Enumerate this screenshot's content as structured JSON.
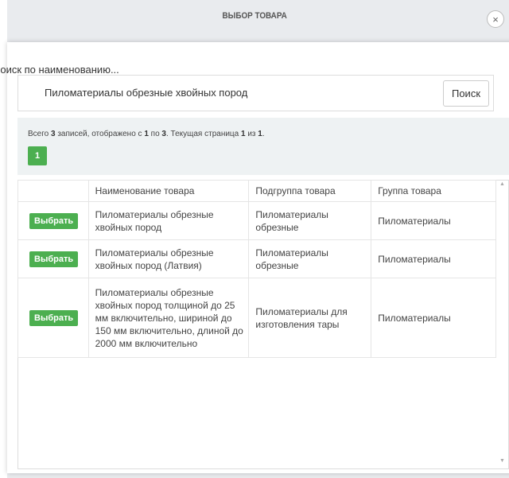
{
  "dialog": {
    "title": "ВЫБОР ТОВАРА",
    "close_glyph": "×"
  },
  "search": {
    "label": "Поиск по наименованию...",
    "value": "Пиломатериалы обрезные хвойных пород",
    "button_label": "Поиск"
  },
  "pagination": {
    "info_prefix": "Всего ",
    "total": "3",
    "info_mid1": " записей, отображено с ",
    "from": "1",
    "info_mid2": " по ",
    "to": "3",
    "info_mid3": ". Текущая страница ",
    "page": "1",
    "info_mid4": " из ",
    "pages": "1",
    "info_suffix": ".",
    "current_page_button": "1",
    "accent_color": "#4caf50"
  },
  "table": {
    "headers": [
      "",
      "Наименование товара",
      "Подгруппа товара",
      "Группа товара"
    ],
    "select_label": "Выбрать",
    "rows": [
      {
        "name": "Пиломатериалы обрезные хвойных пород",
        "subgroup": "Пиломатериалы обрезные",
        "group": "Пиломатериалы"
      },
      {
        "name": "Пиломатериалы обрезные хвойных пород (Латвия)",
        "subgroup": "Пиломатериалы обрезные",
        "group": "Пиломатериалы"
      },
      {
        "name": "Пиломатериалы обрезные хвойных пород толщиной до 25 мм включительно, шириной до 150 мм включительно, длиной до 2000 мм включительно",
        "subgroup": "Пиломатериалы для изготовления тары",
        "group": "Пиломатериалы"
      }
    ]
  },
  "icons": {
    "close": "close-icon",
    "scroll_up": "scroll-up-arrow-icon",
    "scroll_down": "scroll-down-arrow-icon"
  }
}
